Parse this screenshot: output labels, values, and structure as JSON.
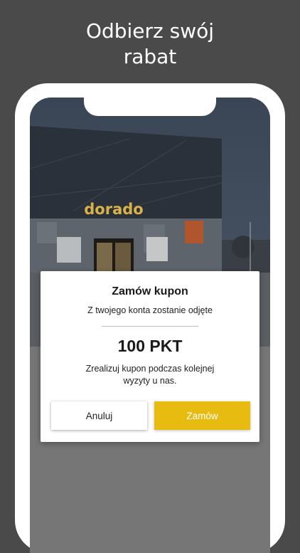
{
  "headline": {
    "line1": "Odbierz swój",
    "line2": "rabat"
  },
  "storefront": {
    "sign_text": "dorado"
  },
  "dialog": {
    "title": "Zamów kupon",
    "subtitle": "Z twojego konta zostanie odjęte",
    "points": "100 PKT",
    "note_line1": "Zrealizuj kupon podczas kolejnej",
    "note_line2": "wyzyty u nas.",
    "cancel_label": "Anuluj",
    "order_label": "Zamów"
  },
  "colors": {
    "accent": "#e8bb10",
    "background": "#4a4a4a",
    "dialog": "#ffffff"
  }
}
